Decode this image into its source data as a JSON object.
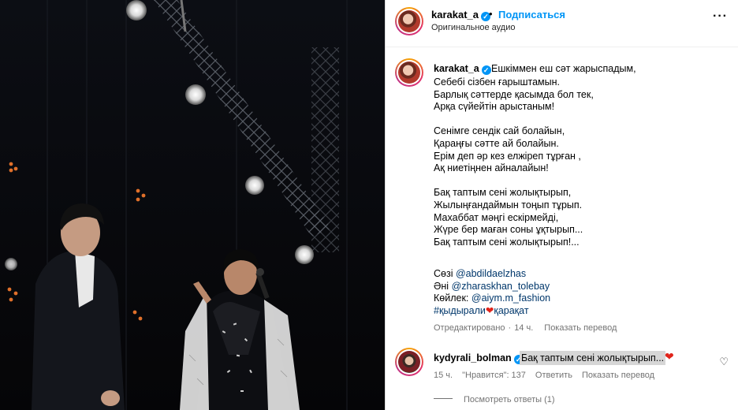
{
  "post": {
    "username": "karakat_a",
    "separator": "•",
    "follow_label": "Подписаться",
    "audio_label": "Оригинальное аудио",
    "more_label": "···"
  },
  "caption": {
    "username": "karakat_a",
    "first_line": "Ешкіммен еш сәт жарыспадым,",
    "body": "Себебі сізбен ғарыштамын.\nБарлық сәттерде қасымда бол тек,\nАрқа сүйейтін арыстаным!\n\nСенімге сендік сай болайын,\nҚараңғы сәтте ай болайын.\nЕрім деп әр кез елжіреп тұрған ,\nАқ ниетіңнен айналайын!\n\nБақ таптым сені жолықтырып,\nЖылыңғандаймын тоңып тұрып.\nМахаббат мәңгі ескірмейді,\nЖүре бер маған соны ұқтырып...\nБақ таптым сені жолықтырып!...",
    "credits": [
      {
        "prefix": "Сөзі ",
        "handle": "@abdildaelzhas"
      },
      {
        "prefix": "Әні ",
        "handle": "@zharaskhan_tolebay"
      },
      {
        "prefix": "Көйлек: ",
        "handle": "@aiym.m_fashion"
      }
    ],
    "hashtag_1": "#қыдырали",
    "hashtag_2": "қарақат"
  },
  "meta": {
    "edited": "Отредактировано",
    "sep": "·",
    "time": "14 ч.",
    "translate": "Показать перевод"
  },
  "comment": {
    "username": "kydyrali_bolman",
    "text": "Бақ таптым сені жолықтырып...",
    "time": "15 ч.",
    "likes": "\"Нравится\": 137",
    "reply": "Ответить",
    "translate": "Показать перевод",
    "view_replies": "Посмотреть ответы (1)"
  },
  "icons": {
    "verified": "verified-badge-icon",
    "heart": "heart-icon",
    "like": "heart-outline-icon",
    "more": "more-options-icon"
  },
  "colors": {
    "accent": "#0095f6",
    "link": "#00376b",
    "heart": "#e0241b"
  }
}
